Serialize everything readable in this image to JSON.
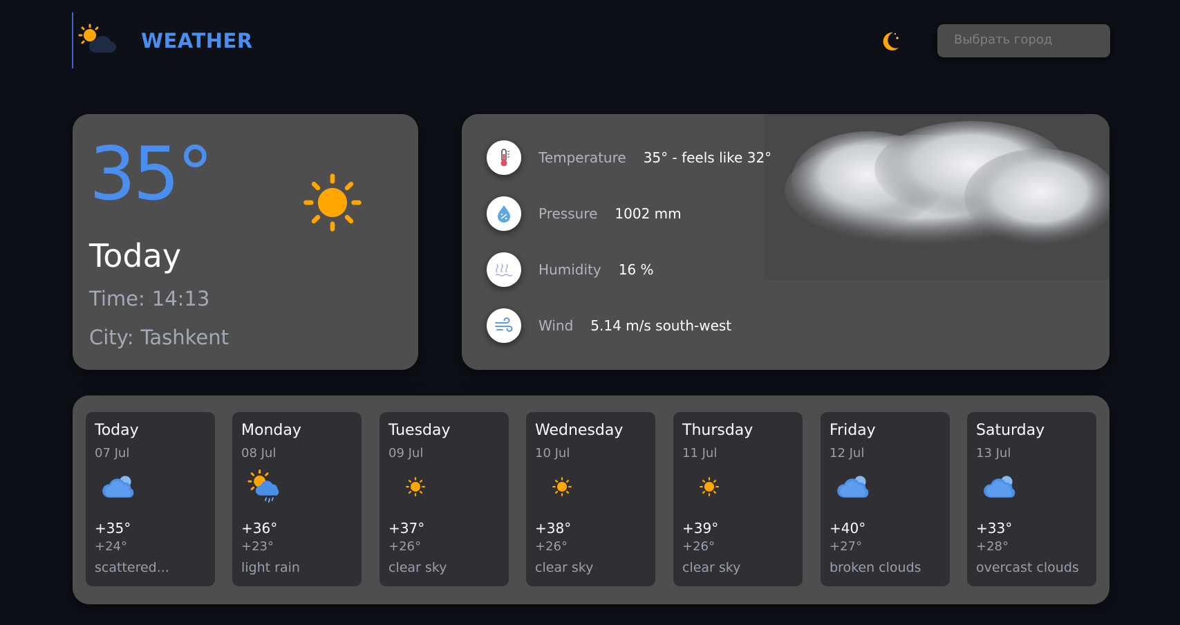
{
  "header": {
    "brand": "WEATHER",
    "logo_icon": "sun-behind-cloud-icon",
    "theme_icon": "moon-icon",
    "city_select_placeholder": "Выбрать город"
  },
  "colors": {
    "accent": "#4a8ff0",
    "background": "#0d1017",
    "card": "#4e4e4e",
    "day_card": "#2f2f34",
    "sun": "#ffa600"
  },
  "current": {
    "temperature": "35°",
    "day_label": "Today",
    "time_label": "Time:",
    "time_value": "14:13",
    "city_label": "City:",
    "city_value": "Tashkent",
    "icon": "sun-icon"
  },
  "details": [
    {
      "label": "Temperature",
      "value": "35° - feels like 32°",
      "icon": "thermometer-icon"
    },
    {
      "label": "Pressure",
      "value": "1002 mm",
      "icon": "pressure-drop-icon"
    },
    {
      "label": "Humidity",
      "value": "16 %",
      "icon": "humidity-waves-icon"
    },
    {
      "label": "Wind",
      "value": "5.14 m/s south-west",
      "icon": "wind-icon"
    }
  ],
  "forecast": [
    {
      "day": "Today",
      "date": "07 Jul",
      "max": "+35°",
      "min": "+24°",
      "desc": "scattered...",
      "icon": "cloud-icon"
    },
    {
      "day": "Monday",
      "date": "08 Jul",
      "max": "+36°",
      "min": "+23°",
      "desc": "light rain",
      "icon": "sun-rain-cloud-icon"
    },
    {
      "day": "Tuesday",
      "date": "09 Jul",
      "max": "+37°",
      "min": "+26°",
      "desc": "clear sky",
      "icon": "sun-icon"
    },
    {
      "day": "Wednesday",
      "date": "10 Jul",
      "max": "+38°",
      "min": "+26°",
      "desc": "clear sky",
      "icon": "sun-icon"
    },
    {
      "day": "Thursday",
      "date": "11 Jul",
      "max": "+39°",
      "min": "+26°",
      "desc": "clear sky",
      "icon": "sun-icon"
    },
    {
      "day": "Friday",
      "date": "12 Jul",
      "max": "+40°",
      "min": "+27°",
      "desc": "broken clouds",
      "icon": "cloud-icon"
    },
    {
      "day": "Saturday",
      "date": "13 Jul",
      "max": "+33°",
      "min": "+28°",
      "desc": "overcast clouds",
      "icon": "cloud-icon"
    }
  ]
}
